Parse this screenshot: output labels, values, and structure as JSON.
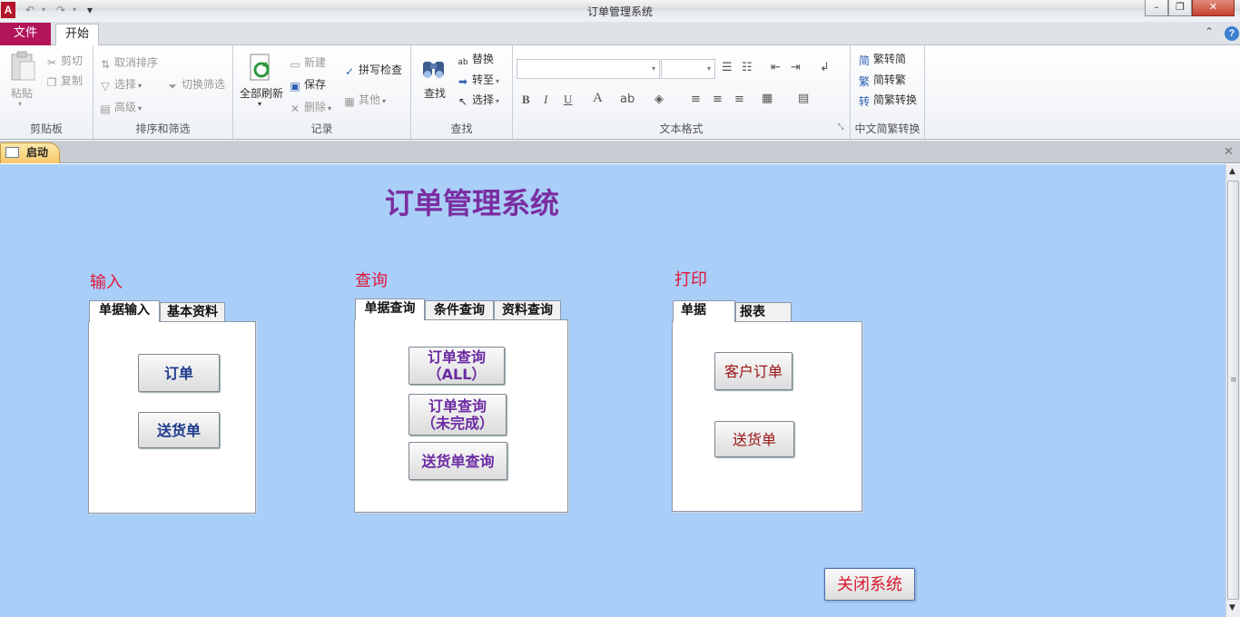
{
  "window": {
    "title": "订单管理系统",
    "logo_letter": "A",
    "qat_undo": "↶",
    "qat_redo": "↷",
    "qat_customize": "▾"
  },
  "ribbon": {
    "tabs": {
      "file": "文件",
      "home": "开始"
    },
    "clipboard": {
      "label": "剪贴板",
      "paste": "粘贴",
      "cut": "剪切",
      "copy": "复制"
    },
    "sort_filter": {
      "label": "排序和筛选",
      "cancel_sort": "取消排序",
      "select": "选择",
      "advanced": "高级",
      "toggle_filter": "切换筛选"
    },
    "records": {
      "label": "记录",
      "refresh_all": "全部刷新",
      "new": "新建",
      "save": "保存",
      "delete": "删除",
      "spell_check": "拼写检查",
      "other": "其他"
    },
    "find": {
      "label": "查找",
      "find": "查找",
      "replace": "替换",
      "goto": "转至",
      "select": "选择"
    },
    "text_format": {
      "label": "文本格式",
      "font_value": "",
      "size_value": "",
      "bold": "B",
      "italic": "I",
      "underline": "U",
      "font_color": "A"
    },
    "chinese_conversion": {
      "label": "中文简繁转换",
      "to_simplified": "繁转简",
      "to_traditional": "简转繁",
      "convert": "简繁转换"
    }
  },
  "document_tab": {
    "label": "启动"
  },
  "form": {
    "title": "订单管理系统",
    "sections": {
      "input": {
        "label": "输入",
        "tabs": [
          "单据输入",
          "基本资料"
        ],
        "buttons": [
          "订单",
          "送货单"
        ]
      },
      "query": {
        "label": "查询",
        "tabs": [
          "单据查询",
          "条件查询",
          "资料查询"
        ],
        "buttons": [
          {
            "line1": "订单查询",
            "line2": "（ALL）"
          },
          {
            "line1": "订单查询",
            "line2": "（未完成）"
          },
          {
            "line1": "送货单查询",
            "line2": ""
          }
        ]
      },
      "print": {
        "label": "打印",
        "tabs": [
          "单据",
          "报表"
        ],
        "buttons": [
          "客户订单",
          "送货单"
        ]
      }
    },
    "close_button": "关闭系统"
  }
}
